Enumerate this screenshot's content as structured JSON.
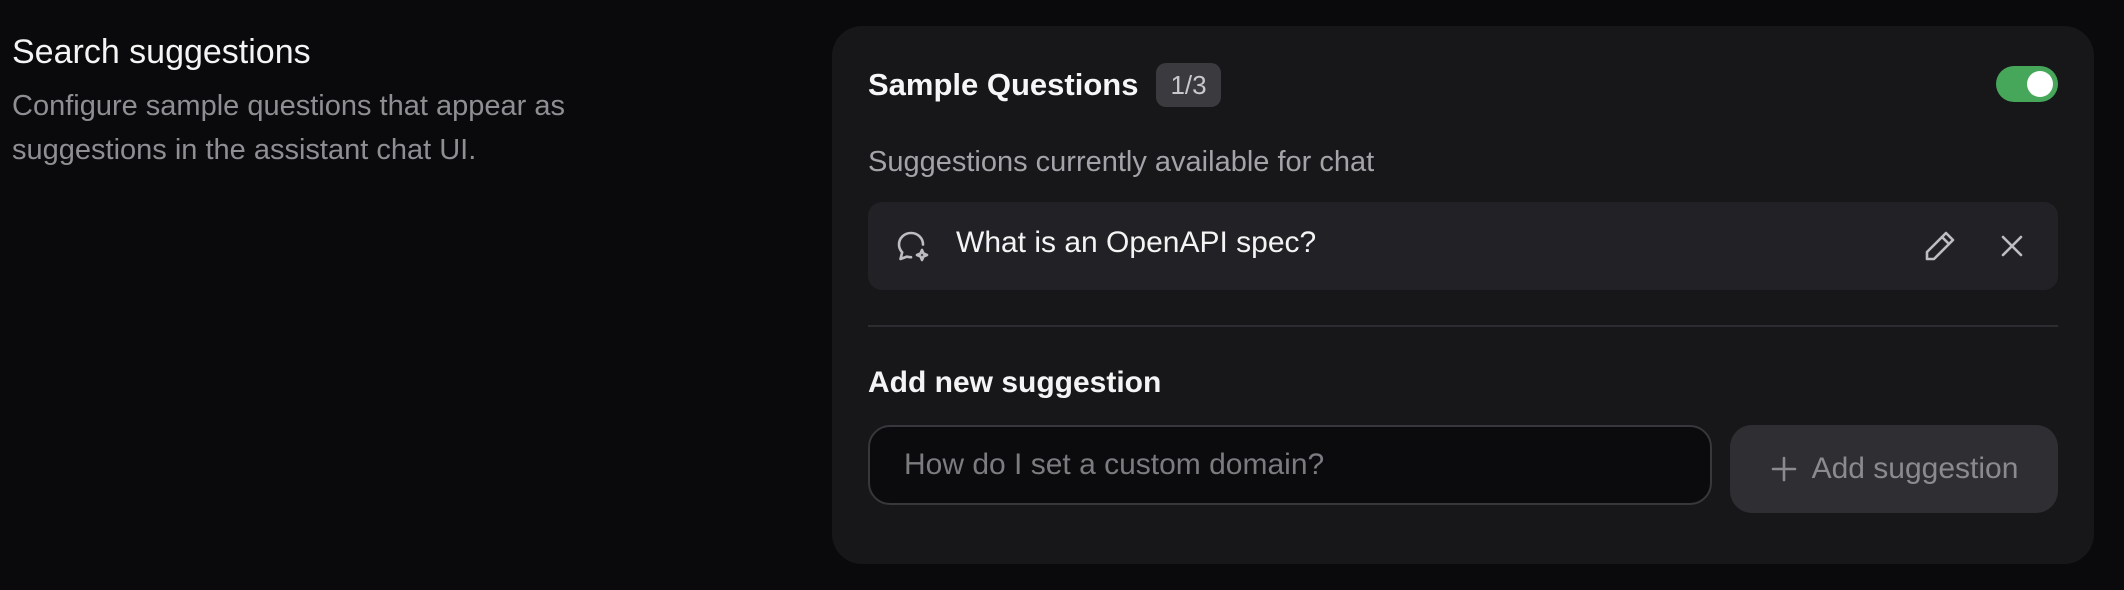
{
  "section": {
    "title": "Search suggestions",
    "description": "Configure sample questions that appear as suggestions in the assistant chat UI."
  },
  "card": {
    "title": "Sample Questions",
    "count": "1/3",
    "enabled": true,
    "subtitle": "Suggestions currently available for chat",
    "suggestions": [
      {
        "text": "What is an OpenAPI spec?",
        "icon": "chat-sparkle-icon"
      }
    ],
    "add": {
      "label": "Add new suggestion",
      "placeholder": "How do I set a custom domain?",
      "value": "",
      "button_label": "Add suggestion"
    }
  },
  "colors": {
    "toggle_on": "#46a75b",
    "background": "#0a0a0c",
    "card": "#17171a"
  }
}
